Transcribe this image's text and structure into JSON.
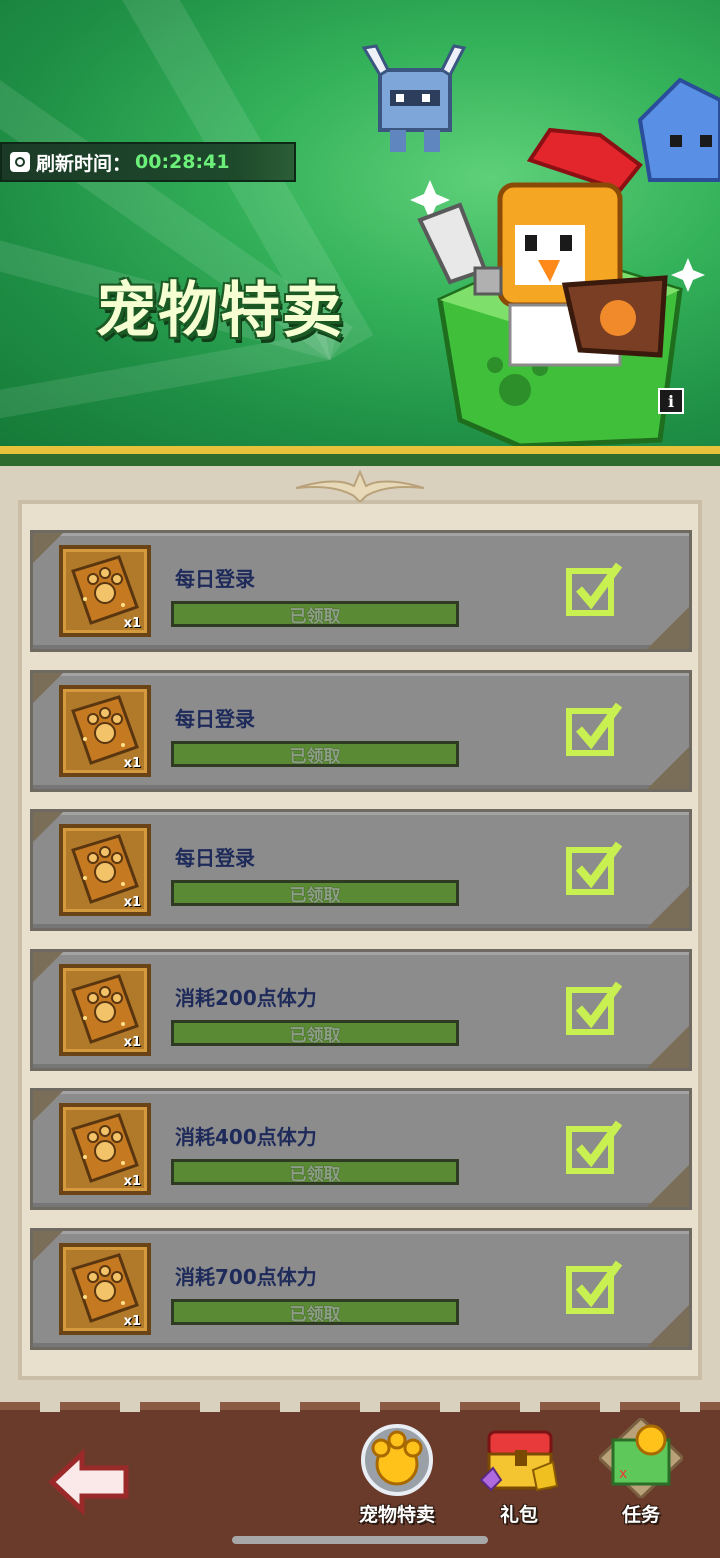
{
  "banner": {
    "timer_label": "刷新时间：",
    "timer_value": "00:28:41",
    "title": "宠物特卖",
    "info_label": "i"
  },
  "tasks": [
    {
      "name": "每日登录",
      "status": "已领取",
      "reward_qty": "x1",
      "progress": 1.0
    },
    {
      "name": "每日登录",
      "status": "已领取",
      "reward_qty": "x1",
      "progress": 1.0
    },
    {
      "name": "每日登录",
      "status": "已领取",
      "reward_qty": "x1",
      "progress": 1.0
    },
    {
      "name": "消耗200点体力",
      "status": "已领取",
      "reward_qty": "x1",
      "progress": 1.0
    },
    {
      "name": "消耗400点体力",
      "status": "已领取",
      "reward_qty": "x1",
      "progress": 1.0
    },
    {
      "name": "消耗700点体力",
      "status": "已领取",
      "reward_qty": "x1",
      "progress": 1.0
    }
  ],
  "bottom_nav": {
    "items": [
      {
        "label": "宠物特卖",
        "icon": "pet-sale-icon"
      },
      {
        "label": "礼包",
        "icon": "gift-chest-icon"
      },
      {
        "label": "任务",
        "icon": "task-map-icon"
      }
    ]
  },
  "colors": {
    "banner_green": "#34b25a",
    "row_gray": "#8c8c8c",
    "bar_green": "#5a8a34",
    "check_green": "#c8f050",
    "bottom_brown": "#6a3a2a",
    "title_text": "#f6ffd2",
    "task_text": "#1e2a5a"
  }
}
